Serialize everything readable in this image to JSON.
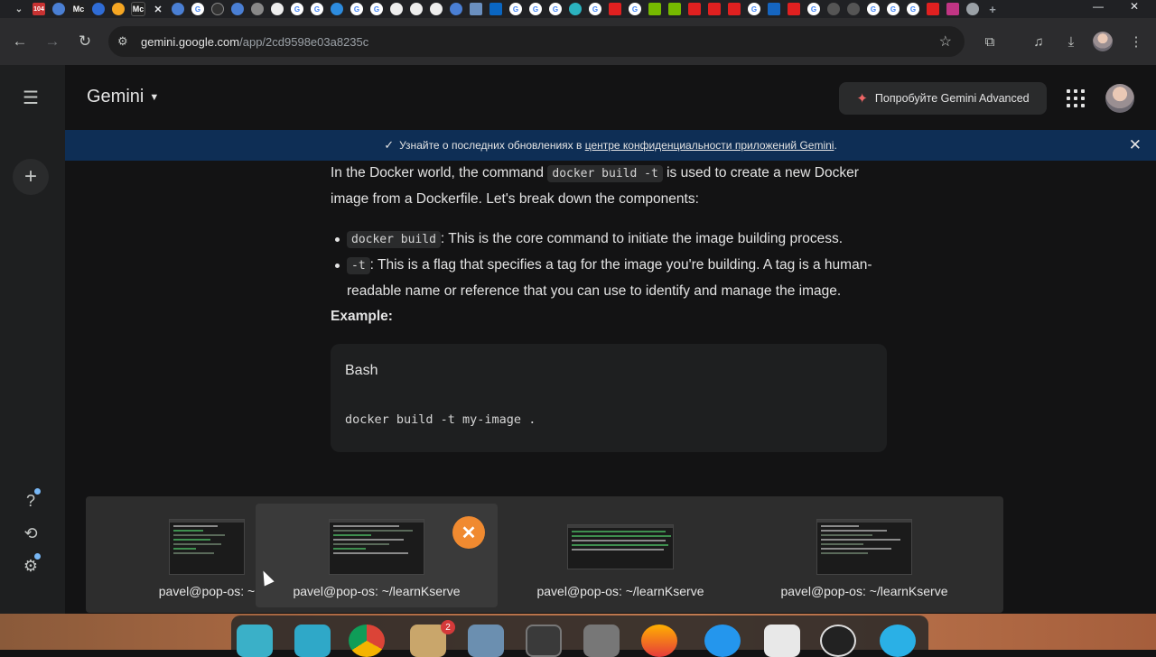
{
  "browser": {
    "tabs": [
      {
        "icon": "tab-search-icon",
        "label": ""
      },
      {
        "icon": "tab-104-icon",
        "label": "104"
      },
      {
        "icon": "tab-gemini-icon",
        "label": ""
      },
      {
        "icon": "tab-medium-icon",
        "label": "Mc"
      },
      {
        "icon": "tab-blank-icon",
        "label": ""
      },
      {
        "icon": "tab-huggingface-icon",
        "label": ""
      },
      {
        "icon": "tab-medium-active-icon",
        "label": "Mc"
      }
    ],
    "url_host": "gemini.google.com",
    "url_path": "/app/2cd9598e03a8235c"
  },
  "header": {
    "brand": "Gemini",
    "advanced_button": "Попробуйте Gemini Advanced"
  },
  "banner": {
    "text_before": "Узнайте о последних обновлениях в",
    "link": "центре конфиденциальности приложений Gemini",
    "text_after": "."
  },
  "content": {
    "intro_1": "In the Docker world, the command",
    "intro_code": "docker build -t",
    "intro_2": "is used to create a new Docker image from a Dockerfile. Let's break down the components:",
    "bullets": [
      {
        "code": "docker build",
        "text": ": This is the core command to initiate the image building process."
      },
      {
        "code": "-t",
        "text": ": This is a flag that specifies a tag for the image you're building. A tag is a human-readable name or reference that you can use to identify and manage the image."
      }
    ],
    "example_heading": "Example:",
    "code_block": {
      "language": "Bash",
      "code": "docker build -t my-image ."
    }
  },
  "switcher": {
    "windows": [
      {
        "label": "pavel@pop-os: ~"
      },
      {
        "label": "pavel@pop-os: ~/learnKserve"
      },
      {
        "label": "pavel@pop-os: ~/learnKserve"
      },
      {
        "label": "pavel@pop-os: ~/learnKserve"
      }
    ],
    "close_glyph": "✕"
  },
  "dock": {
    "badge_count": "2"
  },
  "colors": {
    "banner_bg": "#0e2e55",
    "close_button": "#f08a30",
    "page_bg": "#131314"
  }
}
